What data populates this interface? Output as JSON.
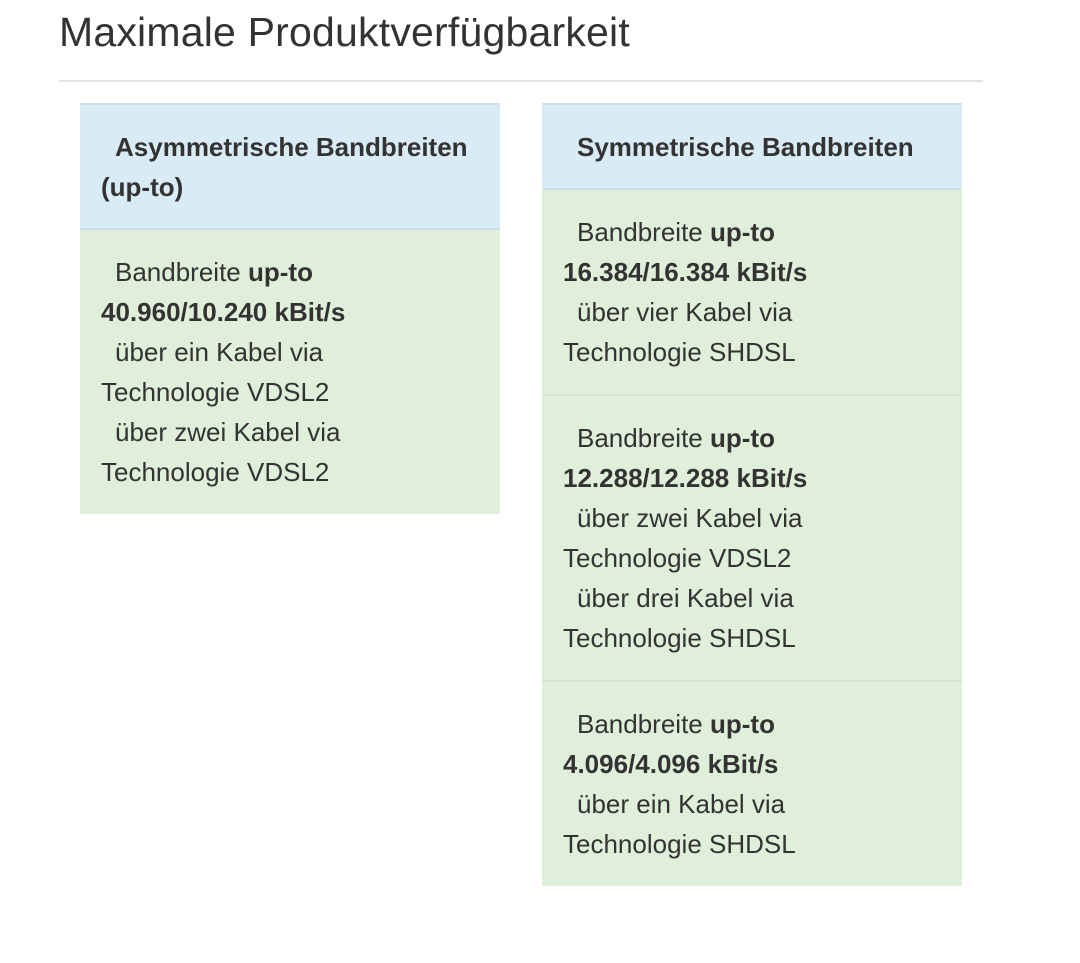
{
  "page": {
    "title": "Maximale Produktverfügbarkeit"
  },
  "asymmetric": {
    "header": "Asymmetrische Bandbreiten (up-to)",
    "cells": [
      {
        "prefix": "Bandbreite",
        "upto": "up-to",
        "rate": "40.960/10.240 kBit/s",
        "options": [
          {
            "text": "über ein Kabel via",
            "tech": "Technologie VDSL2"
          },
          {
            "text": "über zwei Kabel via",
            "tech": "Technologie VDSL2"
          }
        ]
      }
    ]
  },
  "symmetric": {
    "header": "Symmetrische Bandbreiten",
    "cells": [
      {
        "prefix": "Bandbreite",
        "upto": "up-to",
        "rate": "16.384/16.384 kBit/s",
        "options": [
          {
            "text": "über vier Kabel via",
            "tech": "Technologie SHDSL"
          }
        ]
      },
      {
        "prefix": "Bandbreite",
        "upto": "up-to",
        "rate": "12.288/12.288 kBit/s",
        "options": [
          {
            "text": "über zwei Kabel via",
            "tech": "Technologie VDSL2"
          },
          {
            "text": "über drei Kabel via",
            "tech": "Technologie SHDSL"
          }
        ]
      },
      {
        "prefix": "Bandbreite",
        "upto": "up-to",
        "rate": "4.096/4.096 kBit/s",
        "options": [
          {
            "text": "über ein Kabel via",
            "tech": "Technologie SHDSL"
          }
        ]
      }
    ]
  },
  "colors": {
    "header_bg": "#d9ebf5",
    "cell_bg": "#dfefd9",
    "text": "#333333"
  }
}
